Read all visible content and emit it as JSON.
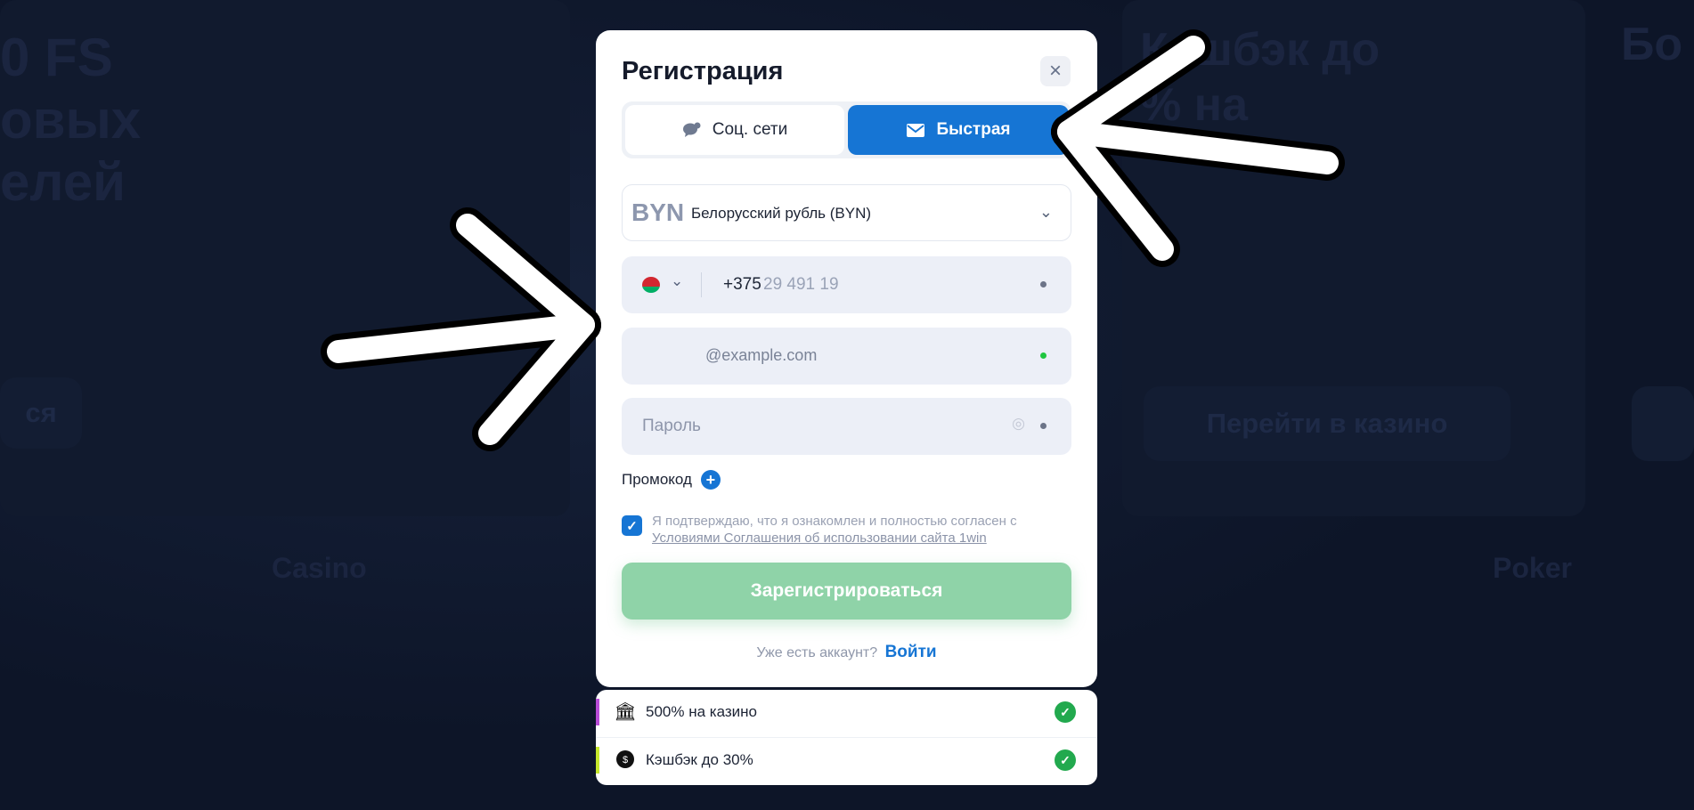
{
  "modal": {
    "title": "Регистрация",
    "close_icon": "×",
    "tabs": [
      {
        "label": "Соц. сети",
        "icon": "chat-bubble-icon",
        "active": false
      },
      {
        "label": "Быстрая",
        "icon": "mail-icon",
        "active": true
      }
    ],
    "currency": {
      "code": "BYN",
      "name": "Белорусский рубль (BYN)"
    },
    "phone": {
      "country": "by-flag",
      "code": "+375",
      "number": "29 491 19"
    },
    "email": {
      "value": "@example.com",
      "status_color": "#20c640"
    },
    "password": {
      "placeholder": "Пароль"
    },
    "promo_label": "Промокод",
    "agreement": {
      "checked": true,
      "text": "Я подтверждаю, что я ознакомлен и полностью согласен с",
      "link": "Условиями Соглашения об использовании сайта 1win"
    },
    "submit_label": "Зарегистрироваться",
    "login_prompt": "Уже есть аккаунт?",
    "login_link": "Войти"
  },
  "bonuses": [
    {
      "label": "500% на казино",
      "accent": "#b84cd6",
      "icon": "casino-icon"
    },
    {
      "label": "Кэшбэк до 30%",
      "accent": "#c6e82c",
      "icon": "cashback-icon"
    }
  ],
  "background": {
    "left_heading": [
      "0 FS",
      "овых",
      "елей"
    ],
    "left_button": "ся",
    "right_heading": [
      "Кэшбэк до",
      "% на"
    ],
    "right_button": "Перейти в казино",
    "casino_title": "Casino",
    "poker_title": "Poker",
    "far_right": "Бо"
  },
  "colors": {
    "accent": "#1675d4",
    "submit": "#8fd3a8",
    "page_bg": "#0d1528"
  }
}
